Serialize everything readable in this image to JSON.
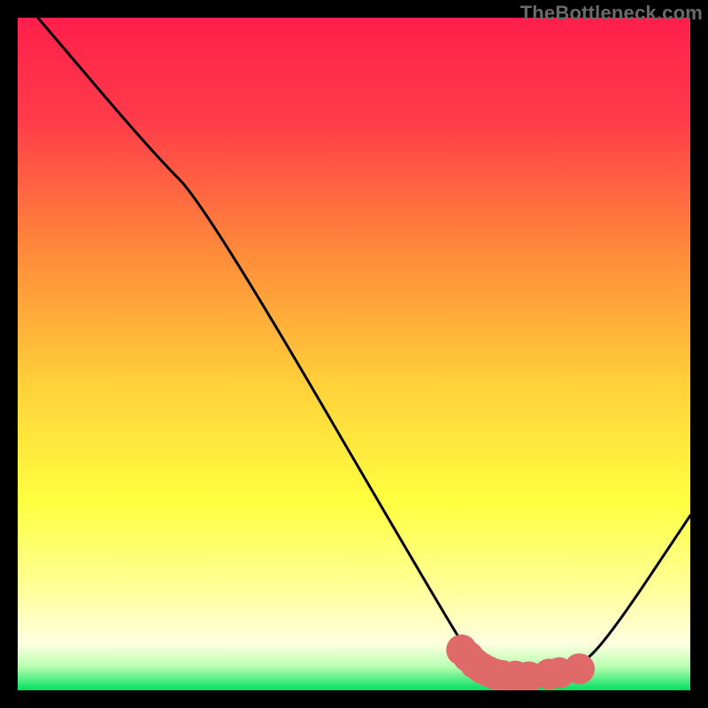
{
  "watermark": "TheBottleneck.com",
  "chart_data": {
    "type": "line",
    "title": "",
    "xlabel": "",
    "ylabel": "",
    "xlim": [
      0,
      100
    ],
    "ylim": [
      0,
      100
    ],
    "grid": false,
    "legend": false,
    "gradient_stops": [
      {
        "offset": 0.0,
        "color": "#ff1f4b"
      },
      {
        "offset": 0.15,
        "color": "#ff3b4a"
      },
      {
        "offset": 0.35,
        "color": "#ff8b3a"
      },
      {
        "offset": 0.55,
        "color": "#ffd23a"
      },
      {
        "offset": 0.72,
        "color": "#ffff40"
      },
      {
        "offset": 0.85,
        "color": "#ffff9a"
      },
      {
        "offset": 0.93,
        "color": "#ffffe0"
      },
      {
        "offset": 0.965,
        "color": "#b8ffb0"
      },
      {
        "offset": 1.0,
        "color": "#00e060"
      }
    ],
    "series": [
      {
        "name": "bottleneck-curve",
        "color": "#000000",
        "points": [
          {
            "x": 3,
            "y": 100
          },
          {
            "x": 20,
            "y": 80
          },
          {
            "x": 28,
            "y": 72
          },
          {
            "x": 63,
            "y": 12
          },
          {
            "x": 68,
            "y": 4
          },
          {
            "x": 72,
            "y": 2
          },
          {
            "x": 78,
            "y": 2
          },
          {
            "x": 83,
            "y": 3
          },
          {
            "x": 88,
            "y": 8
          },
          {
            "x": 100,
            "y": 26
          }
        ]
      }
    ],
    "markers": {
      "name": "optimal-range",
      "color": "#e06a6a",
      "radius": 2.3,
      "points": [
        {
          "x": 66,
          "y": 6
        },
        {
          "x": 67,
          "y": 5
        },
        {
          "x": 68,
          "y": 4
        },
        {
          "x": 69,
          "y": 3.3
        },
        {
          "x": 70,
          "y": 2.8
        },
        {
          "x": 71,
          "y": 2.4
        },
        {
          "x": 72,
          "y": 2.2
        },
        {
          "x": 74,
          "y": 2.1
        },
        {
          "x": 76,
          "y": 2.0
        },
        {
          "x": 79,
          "y": 2.4
        },
        {
          "x": 80.5,
          "y": 2.6
        },
        {
          "x": 83.5,
          "y": 3.2
        }
      ]
    }
  }
}
